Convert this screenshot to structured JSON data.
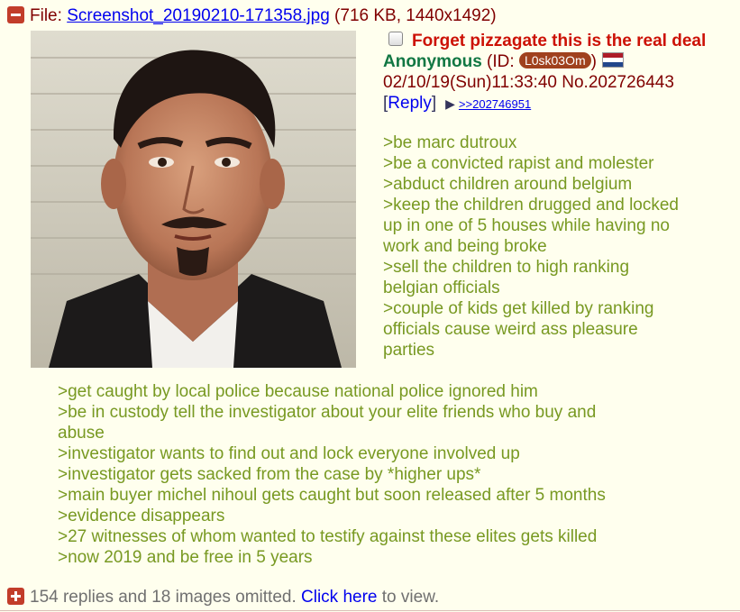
{
  "file": {
    "label": "File: ",
    "name": "Screenshot_20190210-171358.jpg",
    "meta": " (716 KB, 1440x1492)"
  },
  "post": {
    "subject": "Forget pizzagate this is the real deal",
    "name": "Anonymous",
    "id_prefix": " (ID: ",
    "id": "L0sk03Om",
    "id_suffix": ")",
    "datetime": "02/10/19(Sun)11:33:40",
    "no_label": "No.",
    "number": "202726443",
    "reply_open": "[",
    "reply_label": "Reply",
    "reply_close": "]",
    "backlink": ">>202746951"
  },
  "body_right": [
    ">be marc dutroux",
    ">be a convicted rapist and molester",
    ">abduct children around belgium",
    ">keep the children drugged and locked up in one of 5 houses while having no work and being broke",
    ">sell the children to high ranking belgian officials",
    ">couple of kids get killed by ranking officials cause weird ass pleasure parties"
  ],
  "body_full": [
    ">get caught by local police because national police ignored him",
    ">be in custody tell the investigator about your elite friends who buy and abuse",
    ">investigator wants to find out and lock everyone involved up",
    ">investigator gets sacked from the case by *higher ups*",
    ">main buyer michel nihoul gets caught but soon released after 5 months",
    ">evidence disappears",
    ">27 witnesses of whom wanted to testify against these elites gets killed",
    ">now 2019 and be free in 5 years"
  ],
  "omitted": {
    "text": "154 replies and 18 images omitted. ",
    "link": "Click here",
    "suffix": " to view."
  },
  "colors": {
    "background": "#ffffee",
    "subject": "#cc1105",
    "name": "#117743",
    "greentext": "#789922",
    "id_badge": "#a0411e"
  },
  "icons": [
    "minus-icon",
    "checkbox-icon",
    "flag-netherlands-icon",
    "arrow-right-icon",
    "plus-icon"
  ]
}
